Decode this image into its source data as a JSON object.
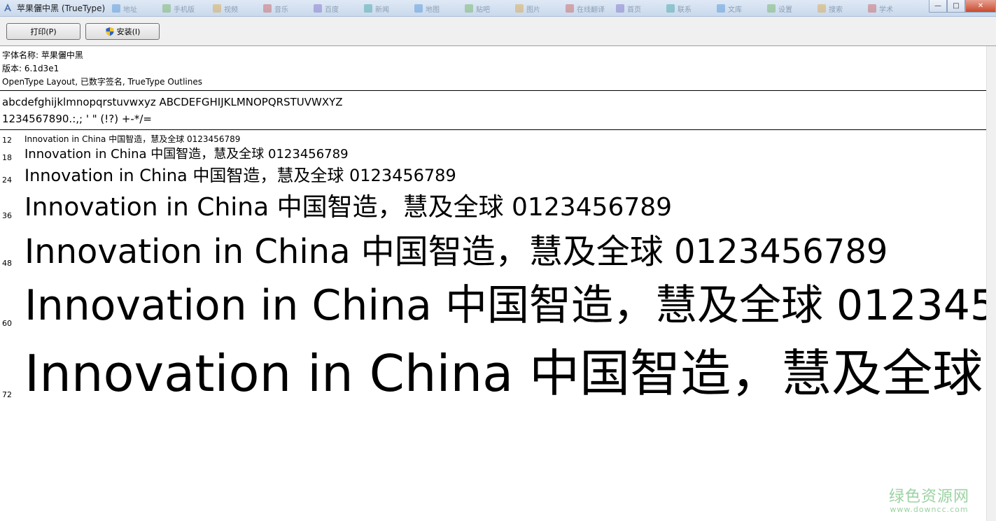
{
  "window": {
    "title": "苹果儷中黑 (TrueType)",
    "background_tabs": [
      "地址",
      "手机版",
      "视频",
      "音乐",
      "百度",
      "新闻",
      "地图",
      "贴吧",
      "图片",
      "在线翻译",
      "首页",
      "联系",
      "文库",
      "设置",
      "搜索",
      "学术"
    ]
  },
  "toolbar": {
    "print_label": "打印(P)",
    "install_label": "安装(I)"
  },
  "font_info": {
    "name_line": "字体名称: 苹果儷中黑",
    "version_line": "版本: 6.1d3e1",
    "features_line": "OpenType Layout, 已数字签名, TrueType Outlines"
  },
  "character_set": {
    "line1": "abcdefghijklmnopqrstuvwxyz ABCDEFGHIJKLMNOPQRSTUVWXYZ",
    "line2": "1234567890.:,; ' \" (!?) +-*/="
  },
  "sample_text": "Innovation in China 中国智造，慧及全球 0123456789",
  "sizes": [
    "12",
    "18",
    "24",
    "36",
    "48",
    "60",
    "72"
  ],
  "watermark": {
    "main": "绿色资源网",
    "sub": "www.downcc.com"
  },
  "colors": {
    "titlebar": "#c9d9ec",
    "toolbar": "#f0f0f0",
    "watermark": "#9bd2a1"
  }
}
